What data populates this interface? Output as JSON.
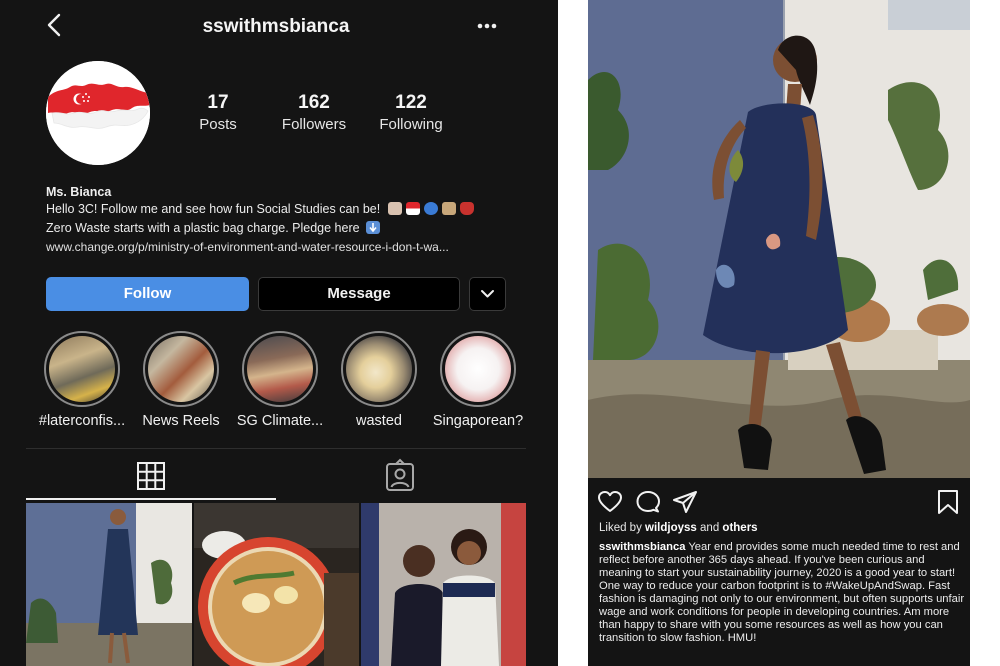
{
  "profile": {
    "username": "sswithmsbianca",
    "stats": [
      {
        "value": "17",
        "label": "Posts"
      },
      {
        "value": "162",
        "label": "Followers"
      },
      {
        "value": "122",
        "label": "Following"
      }
    ],
    "bio": {
      "name": "Ms. Bianca",
      "line1": "Hello 3C! Follow me and see how fun Social Studies can be!",
      "line2": "Zero Waste starts with a plastic bag charge. Pledge here",
      "link": "www.change.org/p/ministry-of-environment-and-water-resource-i-don-t-wa..."
    },
    "buttons": {
      "follow": "Follow",
      "message": "Message"
    },
    "highlights": [
      {
        "label": "#laterconfis..."
      },
      {
        "label": "News Reels"
      },
      {
        "label": "SG Climate..."
      },
      {
        "label": "wasted"
      },
      {
        "label": "Singaporean?"
      }
    ],
    "tabs": [
      {
        "icon": "grid-icon"
      },
      {
        "icon": "tagged-icon"
      }
    ]
  },
  "post": {
    "liked_by_prefix": "Liked by",
    "liked_by_user": "wildjoyss",
    "liked_by_and": "and",
    "liked_by_others": "others",
    "caption_user": "sswithmsbianca",
    "caption_text": "Year end provides some much needed time to rest and reflect before another 365 days ahead. If you've been curious and meaning to start your sustainability journey, 2020 is a good year to start! One way to reduce your carbon footprint is to #WakeUpAndSwap. Fast fashion is damaging not only to our environment, but often supports unfair wage and work conditions for people in developing countries. Am more than happy to share with you some resources as well as how you can transition to slow fashion. HMU!"
  },
  "colors": {
    "background": "#141414",
    "follow_button": "#4a8ee4",
    "text": "#f5f5f5"
  }
}
